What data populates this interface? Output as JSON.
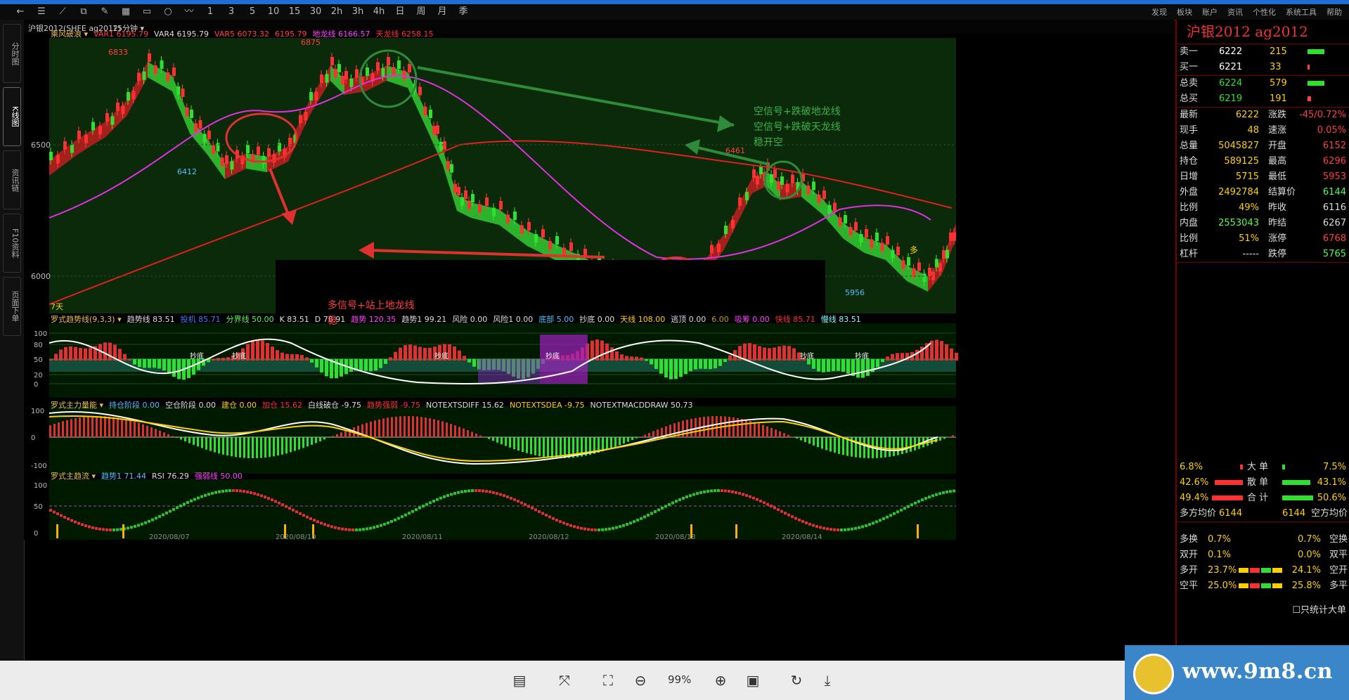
{
  "toolbar": {
    "icons": [
      "back-icon",
      "list-icon",
      "line-chart-icon",
      "candle-icon",
      "pen-icon",
      "pane-icon",
      "window-icon",
      "circle-icon",
      "draw-icon"
    ],
    "periods": [
      "1",
      "3",
      "5",
      "10",
      "15",
      "30",
      "2h",
      "3h",
      "4h",
      "日",
      "周",
      "月",
      "季"
    ],
    "menu": [
      "发现",
      "板块",
      "账户",
      "资讯",
      "个性化",
      "系统工具",
      "帮助"
    ]
  },
  "leftbar": {
    "tabs": [
      "分时图",
      "K线图",
      "资讯链",
      "F10资料",
      "页面下单"
    ],
    "active": "K线图"
  },
  "title": {
    "symbol": "沪银2012(SHFE ag2012)",
    "period": "15分钟"
  },
  "main_legend": {
    "name": "乘风破浪",
    "items": [
      {
        "text": "VAR1 6195.79",
        "color": "#ff4040"
      },
      {
        "text": "VAR4 6195.79",
        "color": "#dddddd"
      },
      {
        "text": "VAR5 6073.32",
        "color": "#ff4040"
      },
      {
        "text": "6195.79",
        "color": "#ff4040"
      },
      {
        "text": "地龙线 6166.57",
        "color": "#ff40ff"
      },
      {
        "text": "天龙线 6258.15",
        "color": "#ff3030"
      }
    ]
  },
  "price_labels": {
    "y6500": "6500",
    "y6000": "6000",
    "p6833": "6833",
    "p6875": "6875",
    "p6412": "6412",
    "p6461": "6461",
    "p5956": "5956",
    "days": "7天"
  },
  "annotations": {
    "sell": [
      "空信号+跌破地龙线",
      "空信号+跌破天龙线",
      "稳开空"
    ],
    "buy": [
      "多信号+站上地龙线",
      "稳"
    ],
    "duo": "多"
  },
  "ind1_legend": {
    "name": "罗式趋势线(9,3,3)",
    "items": [
      {
        "text": "趋势线 83.51",
        "color": "#dddddd"
      },
      {
        "text": "投机 85.71",
        "color": "#3d7bff"
      },
      {
        "text": "分界线 50.00",
        "color": "#50ff50"
      },
      {
        "text": "K 83.51",
        "color": "#dddddd"
      },
      {
        "text": "D 78.91",
        "color": "#dddddd"
      },
      {
        "text": "趋势 120.35",
        "color": "#ff40ff"
      },
      {
        "text": "趋势1 99.21",
        "color": "#dddddd"
      },
      {
        "text": "风险 0.00",
        "color": "#dddddd"
      },
      {
        "text": "风险1 0.00",
        "color": "#dddddd"
      },
      {
        "text": "底部 5.00",
        "color": "#50c0ff"
      },
      {
        "text": "抄底 0.00",
        "color": "#dddddd"
      },
      {
        "text": "天线 108.00",
        "color": "#ffd000"
      },
      {
        "text": "逃顶 0.00",
        "color": "#dddddd"
      },
      {
        "text": "6.00",
        "color": "#c8a000"
      },
      {
        "text": "吸筹 0.00",
        "color": "#ff40ff"
      },
      {
        "text": "快线 85.71",
        "color": "#ff3030"
      },
      {
        "text": "慢线 83.51",
        "color": "#80ffff"
      }
    ],
    "axis": [
      "100",
      "80",
      "50",
      "20",
      "0"
    ],
    "chaodi": "抄底"
  },
  "ind2_legend": {
    "name": "罗式主力量能",
    "items": [
      {
        "text": "持仓阶段 0.00",
        "color": "#50c0ff"
      },
      {
        "text": "空仓阶段 0.00",
        "color": "#dddddd"
      },
      {
        "text": "建仓 0.00",
        "color": "#ffd000"
      },
      {
        "text": "加仓 15.62",
        "color": "#ff3030"
      },
      {
        "text": "白线破仓 -9.75",
        "color": "#dddddd"
      },
      {
        "text": "趋势强弱 -9.75",
        "color": "#ff3030"
      },
      {
        "text": "NOTEXTSDIFF 15.62",
        "color": "#dddddd"
      },
      {
        "text": "NOTEXTSDEA -9.75",
        "color": "#ffd000"
      },
      {
        "text": "NOTEXTMACDDRAW 50.73",
        "color": "#dddddd"
      }
    ],
    "axis": [
      "100",
      "0",
      "-100"
    ]
  },
  "ind3_legend": {
    "name": "罗式主趋流",
    "items": [
      {
        "text": "趋势1 71.44",
        "color": "#50c0ff"
      },
      {
        "text": "RSI 76.29",
        "color": "#dddddd"
      },
      {
        "text": "强弱线 50.00",
        "color": "#ff40ff"
      }
    ],
    "axis": [
      "100",
      "50",
      "0"
    ]
  },
  "date_axis": [
    "2020/08/07",
    "2020/08/10",
    "2020/08/11",
    "2020/08/12",
    "2020/08/13",
    "2020/08/14"
  ],
  "quote_panel": {
    "title": "沪银2012  ag2012",
    "asks": [
      {
        "label": "卖一",
        "price": "6222",
        "vol": "215"
      },
      {
        "label": "买一",
        "price": "6221",
        "vol": "33"
      }
    ],
    "totals": [
      {
        "label": "总卖",
        "price": "6224",
        "vol": "579"
      },
      {
        "label": "总买",
        "price": "6219",
        "vol": "191"
      }
    ],
    "fields": [
      {
        "l1": "最新",
        "v1": "6222",
        "l2": "涨跌",
        "v2": "-45/0.72%",
        "c1": "#ffd000",
        "c2": "#ff4040"
      },
      {
        "l1": "现手",
        "v1": "48",
        "l2": "速涨",
        "v2": "0.05%",
        "c1": "#ffd000",
        "c2": "#ff4040"
      },
      {
        "l1": "总量",
        "v1": "5045827",
        "l2": "开盘",
        "v2": "6152",
        "c1": "#ffd000",
        "c2": "#ff4040"
      },
      {
        "l1": "持仓",
        "v1": "589125",
        "l2": "最高",
        "v2": "6296",
        "c1": "#ffd000",
        "c2": "#ff4040"
      },
      {
        "l1": "日增",
        "v1": "5715",
        "l2": "最低",
        "v2": "5953",
        "c1": "#ffd000",
        "c2": "#ff4040"
      },
      {
        "l1": "外盘",
        "v1": "2492784",
        "l2": "结算价",
        "v2": "6144",
        "c1": "#ffd000",
        "c2": "#50ff50"
      },
      {
        "l1": "比例",
        "v1": "49%",
        "l2": "昨收",
        "v2": "6116",
        "c1": "#ffd000",
        "c2": "#dddddd"
      },
      {
        "l1": "内盘",
        "v1": "2553043",
        "l2": "昨结",
        "v2": "6267",
        "c1": "#50ff50",
        "c2": "#dddddd"
      },
      {
        "l1": "比例",
        "v1": "51%",
        "l2": "涨停",
        "v2": "6768",
        "c1": "#ffd000",
        "c2": "#ff4040"
      },
      {
        "l1": "杠杆",
        "v1": "-----",
        "l2": "跌停",
        "v2": "5765",
        "c1": "#dddddd",
        "c2": "#50ff50"
      }
    ],
    "flow": [
      {
        "left": "6.8%",
        "label": "大 单",
        "right": "7.5%"
      },
      {
        "left": "42.6%",
        "label": "散 单",
        "right": "43.1%"
      },
      {
        "left": "49.4%",
        "label": "合 计",
        "right": "50.6%"
      }
    ],
    "avg": {
      "left": "多方均价",
      "lv": "6144",
      "rv": "6144",
      "right": "空方均价"
    },
    "changes": [
      {
        "l": "多换",
        "lv": "0.7%",
        "rv": "0.7%",
        "r": "空换"
      },
      {
        "l": "双开",
        "lv": "0.1%",
        "rv": "0.0%",
        "r": "双平"
      },
      {
        "l": "多开",
        "lv": "23.7%",
        "rv": "24.1%",
        "r": "空开"
      },
      {
        "l": "空平",
        "lv": "25.0%",
        "rv": "25.8%",
        "r": "多平"
      }
    ],
    "checkbox": "只统计大单"
  },
  "bottombar": {
    "zoom": "99%"
  },
  "watermark": "www.9m8.cn",
  "colors": {
    "bull": "#ff3030",
    "bear": "#33dd33",
    "bg": "#0a2a0a",
    "panel": "#001800"
  }
}
